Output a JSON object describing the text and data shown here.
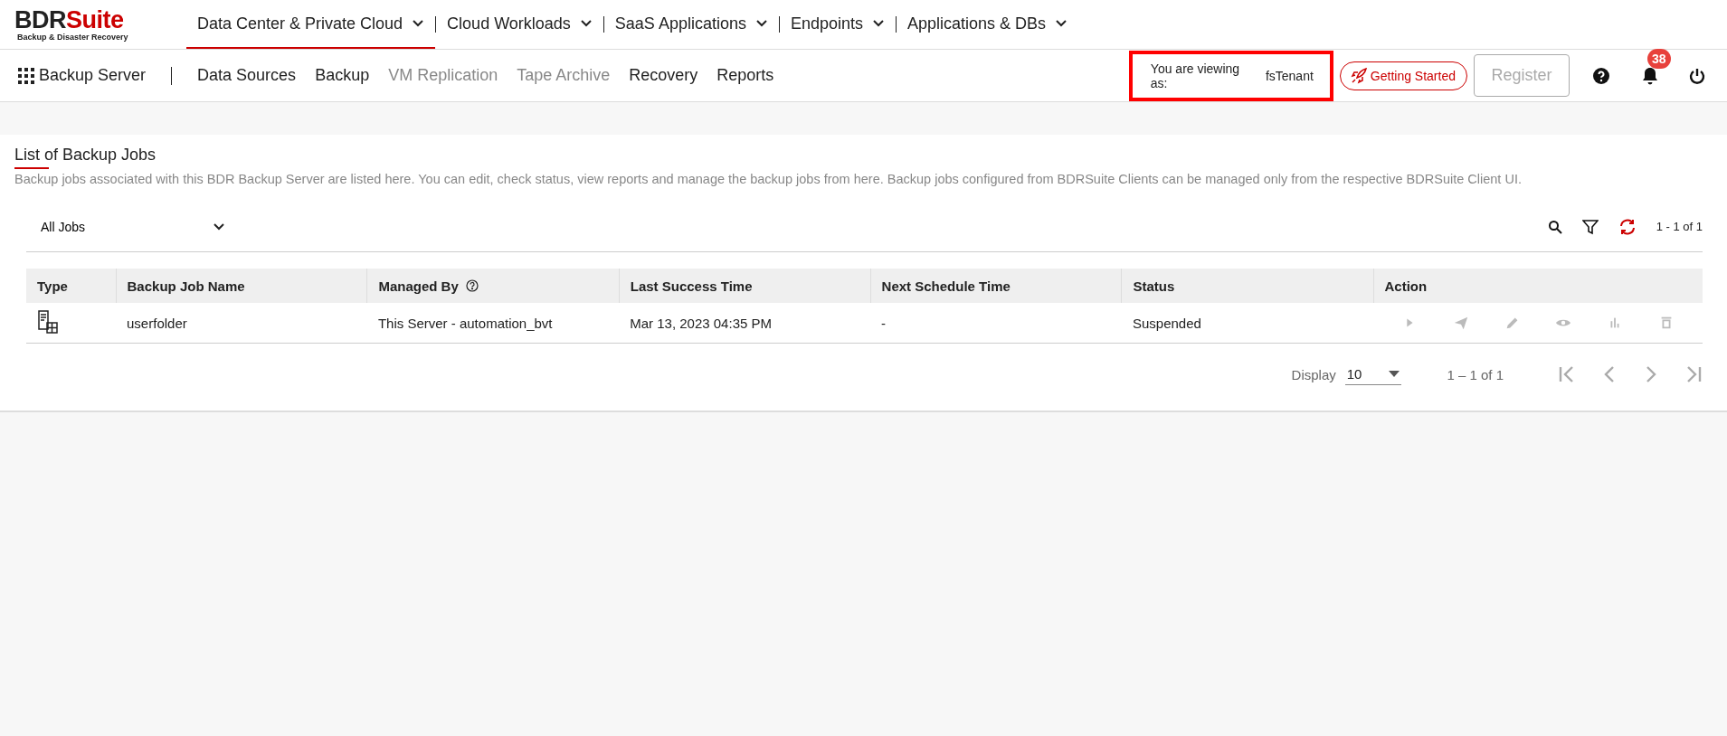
{
  "brand": {
    "prefix": "BDR",
    "suffix": "Suite",
    "tagline": "Backup & Disaster Recovery"
  },
  "main_nav": [
    {
      "label": "Data Center & Private Cloud",
      "selected": true
    },
    {
      "label": "Cloud Workloads",
      "selected": false
    },
    {
      "label": "SaaS Applications",
      "selected": false
    },
    {
      "label": "Endpoints",
      "selected": false
    },
    {
      "label": "Applications & DBs",
      "selected": false
    }
  ],
  "sub_nav": {
    "product": "Backup Server",
    "items": [
      {
        "label": "Data Sources",
        "disabled": false
      },
      {
        "label": "Backup",
        "disabled": false
      },
      {
        "label": "VM Replication",
        "disabled": true
      },
      {
        "label": "Tape Archive",
        "disabled": true
      },
      {
        "label": "Recovery",
        "disabled": false
      },
      {
        "label": "Reports",
        "disabled": false
      }
    ]
  },
  "viewing": {
    "label": "You are viewing as:",
    "user": "fsTenant"
  },
  "getting_started": "Getting Started",
  "register": {
    "label": "Register",
    "disabled": true
  },
  "notifications": {
    "count": "38"
  },
  "page": {
    "title": "List of Backup Jobs",
    "description": "Backup jobs associated with this BDR Backup Server are listed here. You can edit, check status, view reports and manage the backup jobs from here. Backup jobs configured from BDRSuite Clients can be managed only from the respective BDRSuite Client UI.",
    "filter": {
      "value": "All Jobs"
    },
    "count": "1 - 1 of 1",
    "columns": [
      "Type",
      "Backup Job Name",
      "Managed By",
      "Last Success Time",
      "Next Schedule Time",
      "Status",
      "Action"
    ],
    "rows": [
      {
        "name": "userfolder",
        "managed_by": "This Server - automation_bvt",
        "last_success": "Mar 13, 2023 04:35 PM",
        "next_schedule": "-",
        "status": "Suspended",
        "actions_disabled": true
      }
    ],
    "pagination": {
      "label": "Display",
      "page_size": "10",
      "range": "1 – 1 of 1"
    }
  }
}
